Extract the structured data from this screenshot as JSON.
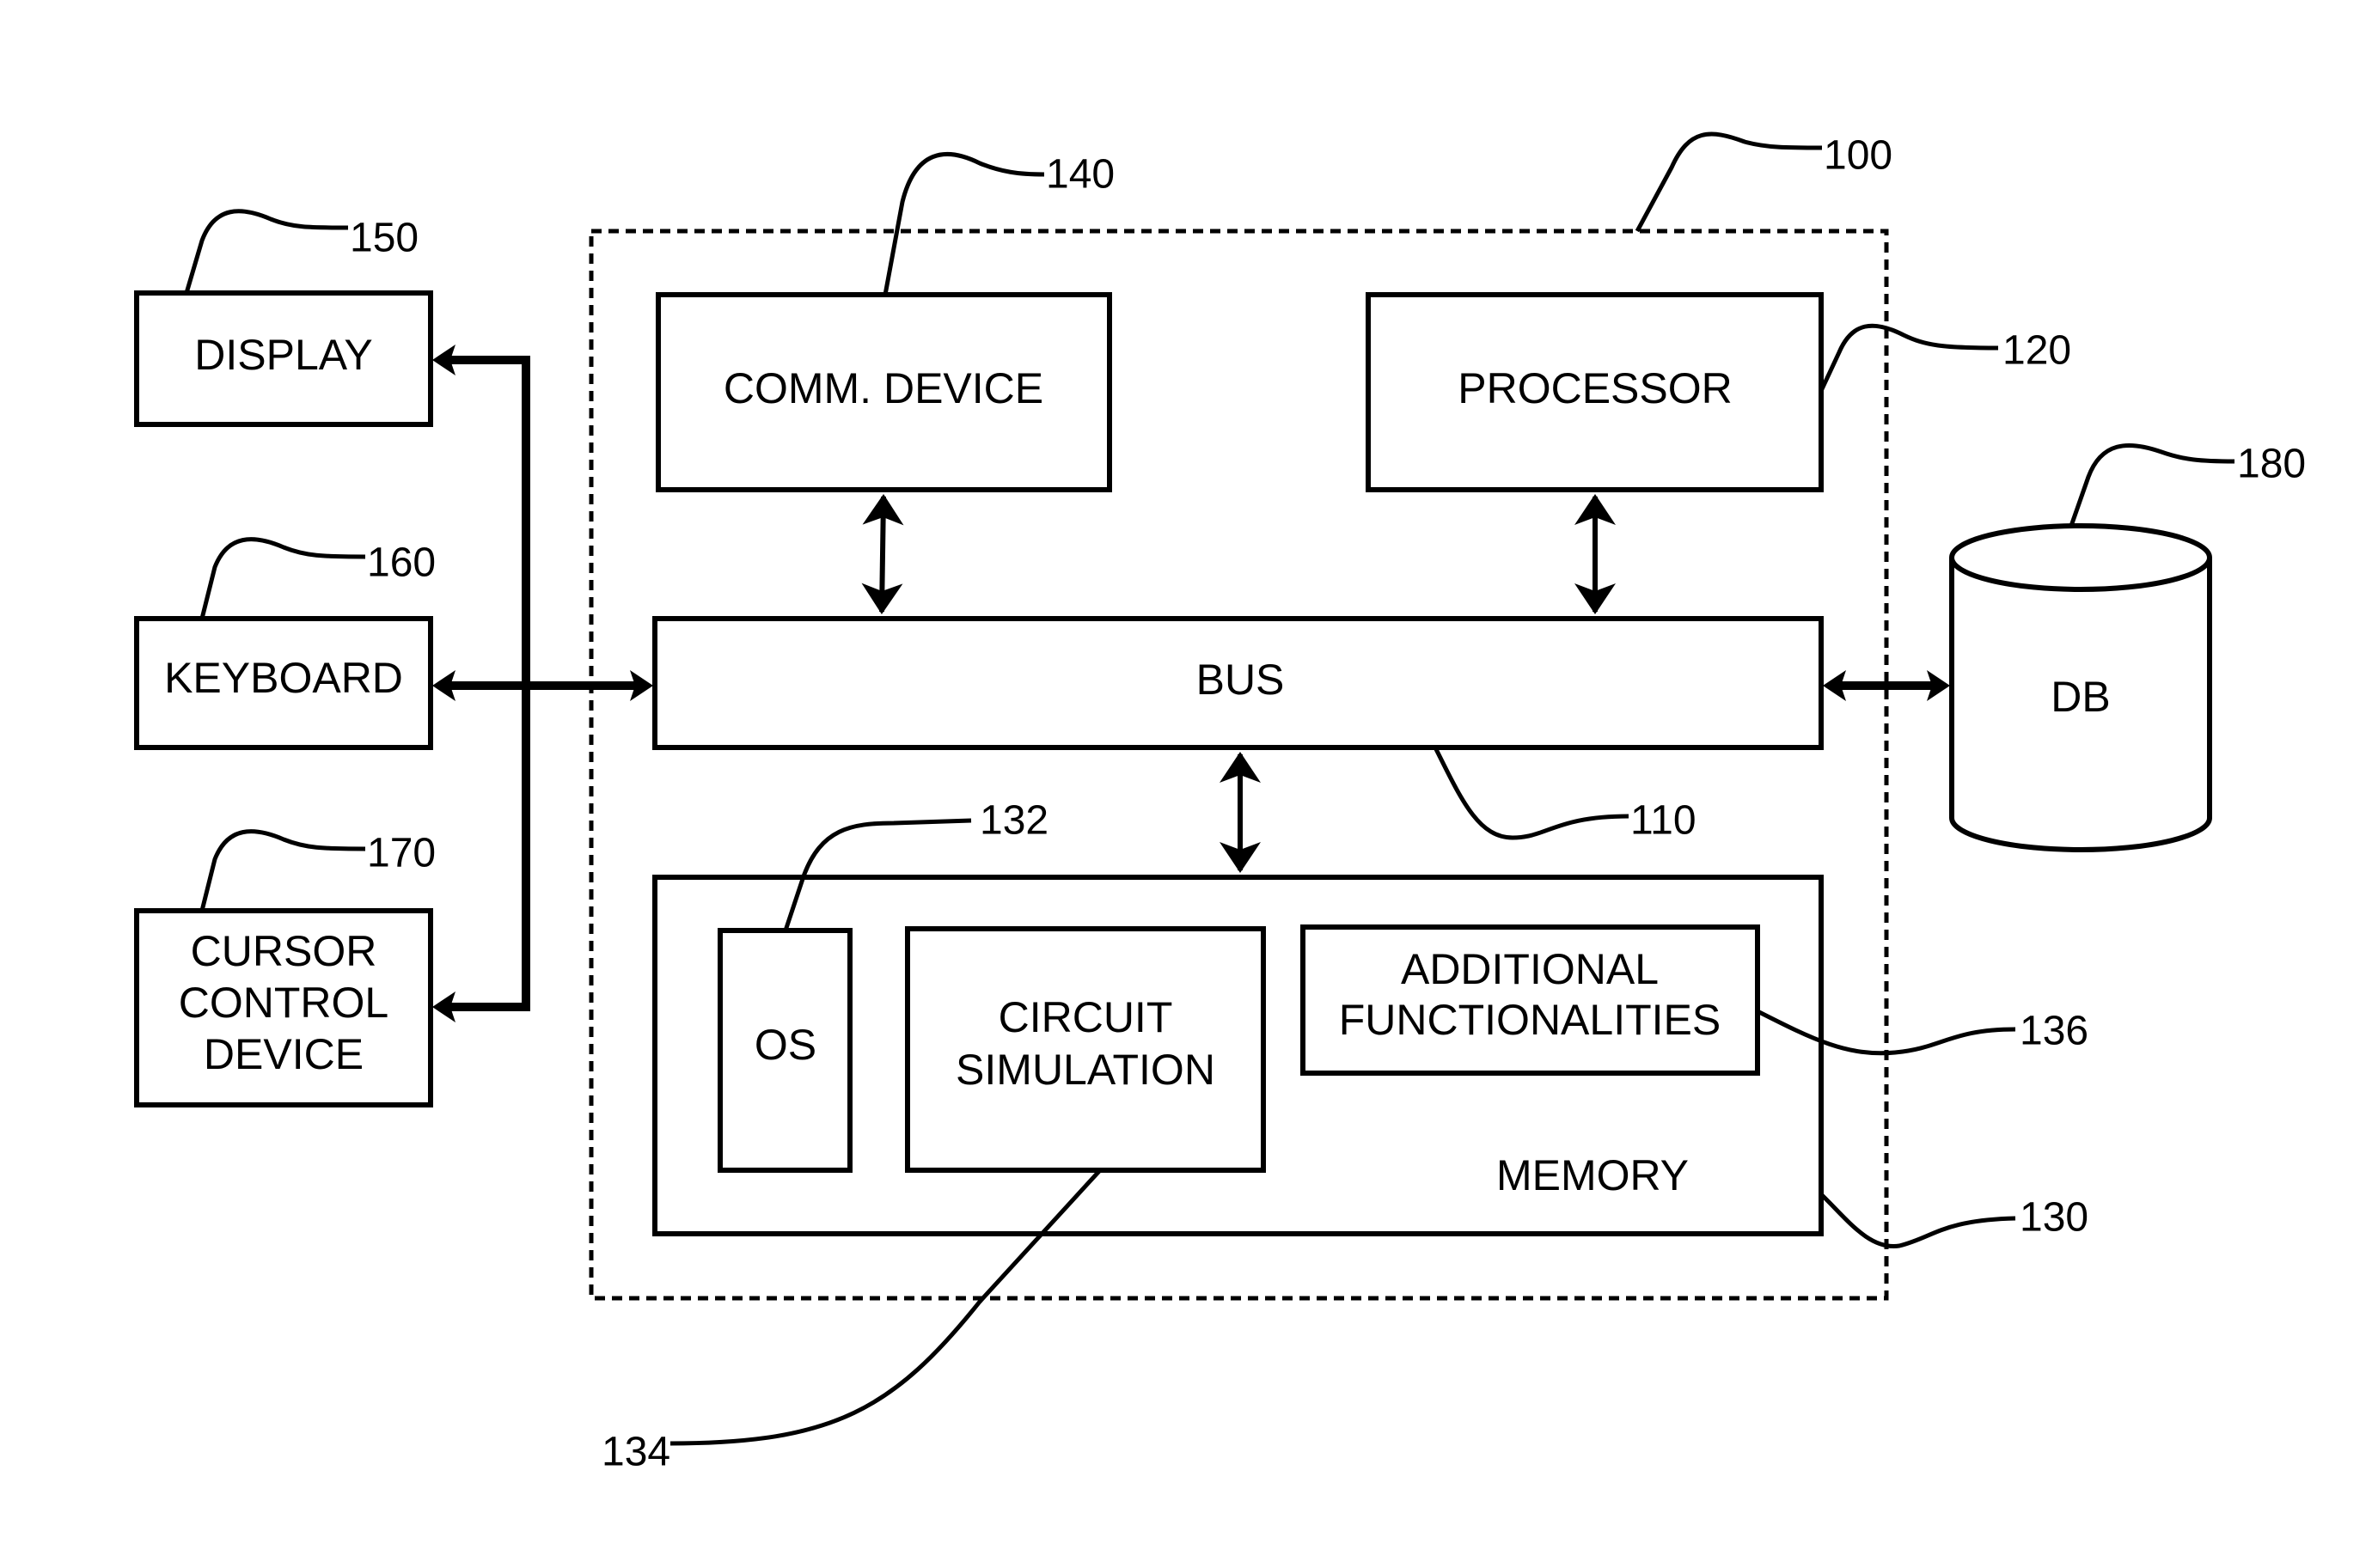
{
  "figure": {
    "system": {
      "ref": "100"
    },
    "comm_device": {
      "label": "COMM. DEVICE",
      "ref": "140"
    },
    "processor": {
      "label": "PROCESSOR",
      "ref": "120"
    },
    "bus": {
      "label": "BUS",
      "ref": "110"
    },
    "memory": {
      "label": "MEMORY",
      "ref": "130"
    },
    "os": {
      "label": "OS",
      "ref": "132"
    },
    "circuit_simulation": {
      "line1": "CIRCUIT",
      "line2": "SIMULATION",
      "ref": "134"
    },
    "additional_functionalities": {
      "line1": "ADDITIONAL",
      "line2": "FUNCTIONALITIES",
      "ref": "136"
    },
    "display": {
      "label": "DISPLAY",
      "ref": "150"
    },
    "keyboard": {
      "label": "KEYBOARD",
      "ref": "160"
    },
    "cursor_control": {
      "line1": "CURSOR",
      "line2": "CONTROL",
      "line3": "DEVICE",
      "ref": "170"
    },
    "db": {
      "label": "DB",
      "ref": "180"
    }
  }
}
